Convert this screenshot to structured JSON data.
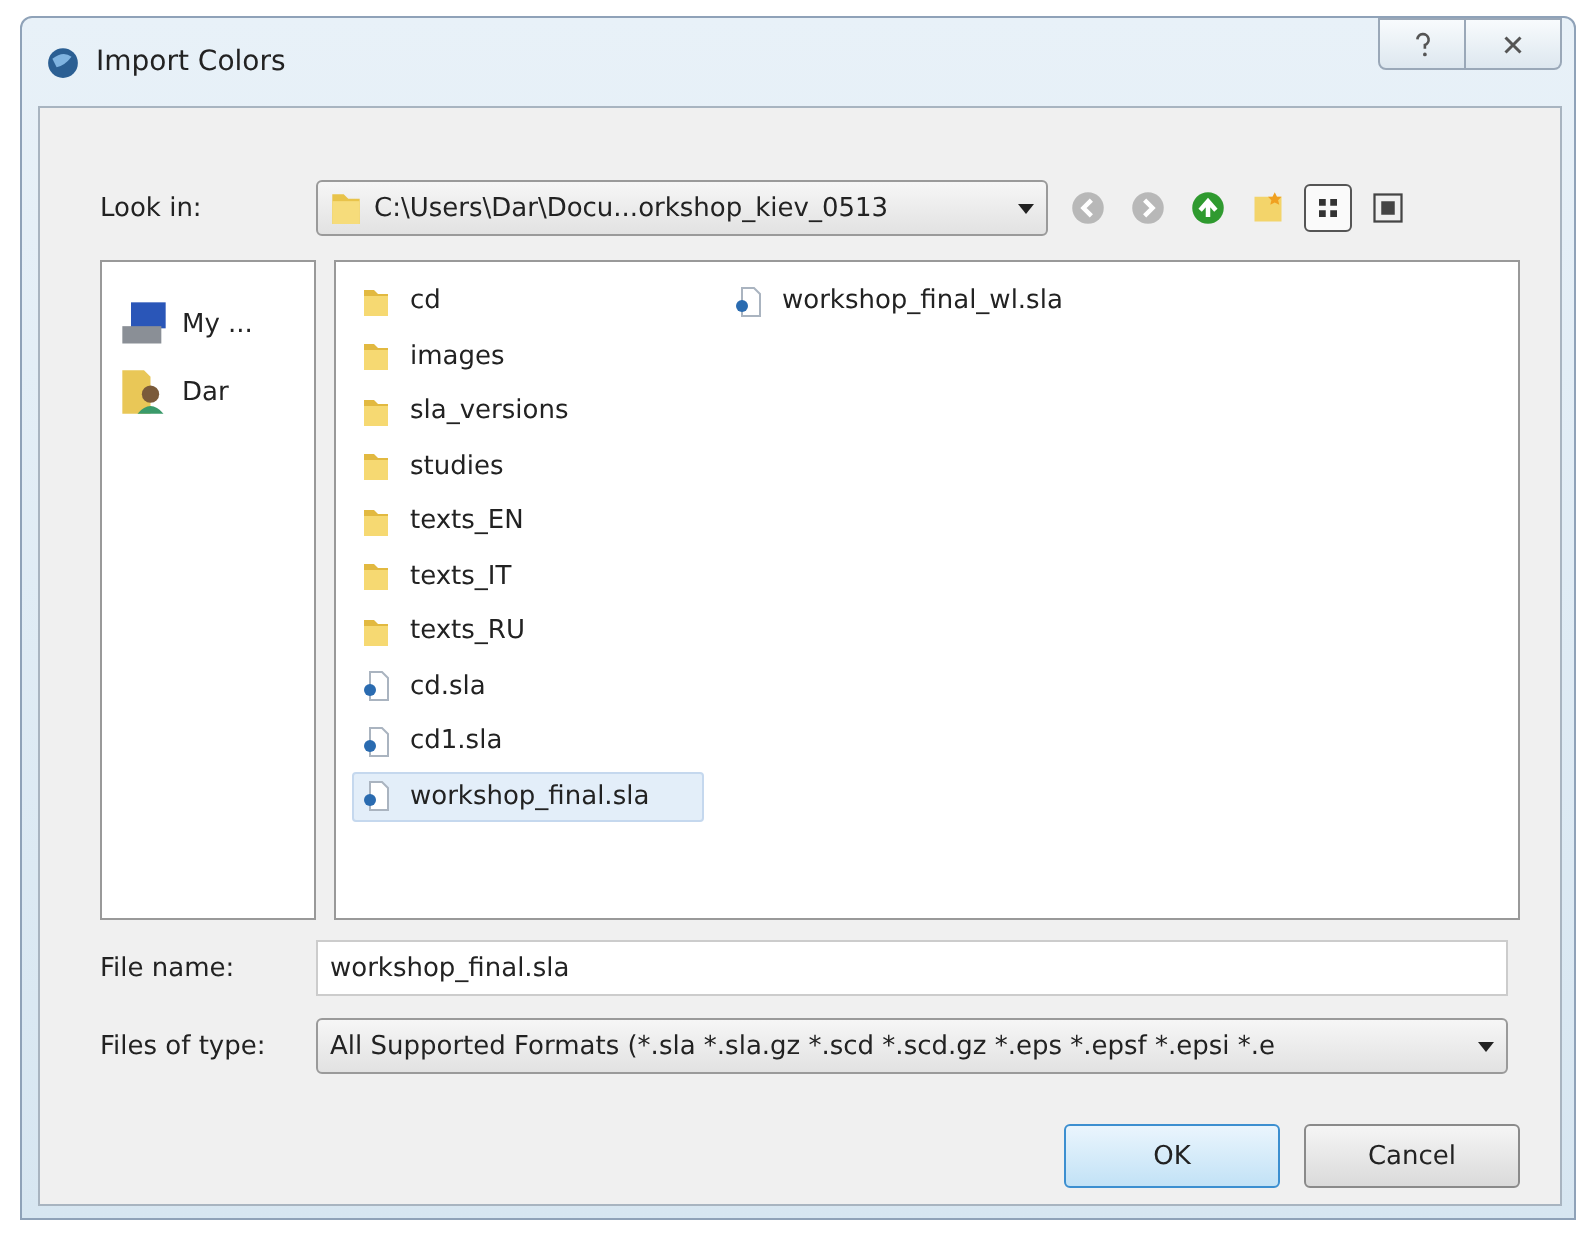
{
  "window": {
    "title": "Import Colors",
    "title_buttons": [
      {
        "kind": "help"
      },
      {
        "kind": "close"
      }
    ]
  },
  "look_in": {
    "label": "Look in:",
    "value": "C:\\Users\\Dar\\Docu...orkshop_kiev_0513"
  },
  "toolbar": [
    {
      "kind": "back",
      "disabled": true
    },
    {
      "kind": "forward",
      "disabled": true
    },
    {
      "kind": "up",
      "disabled": false
    },
    {
      "kind": "new-folder"
    },
    {
      "kind": "list-view",
      "selected": true
    },
    {
      "kind": "detail-view",
      "selected": false
    }
  ],
  "sidebar": {
    "items": [
      {
        "kind": "computer",
        "label": "My ..."
      },
      {
        "kind": "user",
        "label": "Dar"
      }
    ]
  },
  "files": [
    {
      "kind": "folder",
      "name": "cd",
      "selected": false
    },
    {
      "kind": "folder",
      "name": "images",
      "selected": false
    },
    {
      "kind": "folder",
      "name": "sla_versions",
      "selected": false
    },
    {
      "kind": "folder",
      "name": "studies",
      "selected": false
    },
    {
      "kind": "folder",
      "name": "texts_EN",
      "selected": false
    },
    {
      "kind": "folder",
      "name": "texts_IT",
      "selected": false
    },
    {
      "kind": "folder",
      "name": "texts_RU",
      "selected": false
    },
    {
      "kind": "file",
      "name": "cd.sla",
      "selected": false
    },
    {
      "kind": "file",
      "name": "cd1.sla",
      "selected": false
    },
    {
      "kind": "file",
      "name": "workshop_final.sla",
      "selected": true
    },
    {
      "kind": "file",
      "name": "workshop_final_wl.sla",
      "selected": false
    }
  ],
  "file_name": {
    "label": "File name:",
    "value": "workshop_final.sla"
  },
  "file_type": {
    "label": "Files of type:",
    "value": "All Supported Formats (*.sla *.sla.gz *.scd *.scd.gz *.eps *.epsf *.epsi *.e"
  },
  "buttons": [
    {
      "label": "OK",
      "default": true
    },
    {
      "label": "Cancel",
      "default": false
    }
  ]
}
